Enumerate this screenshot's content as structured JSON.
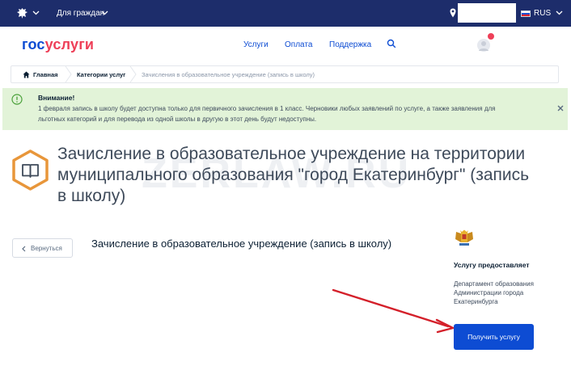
{
  "topbar": {
    "for_citizens_label": "Для граждан",
    "language": "RUS"
  },
  "header": {
    "logo_part1": "гос",
    "logo_part2": "услуги",
    "nav": [
      "Услуги",
      "Оплата",
      "Поддержка"
    ]
  },
  "breadcrumbs": [
    "Главная",
    "Категории услуг",
    "Зачисления в образовательное учреждение (запись в школу)"
  ],
  "notice": {
    "title": "Внимание!",
    "text": "1 февраля запись в школу будет доступна только для первичного зачисления в 1 класс. Черновики любых заявлений по услуге, а также заявления для льготных категорий и для перевода из одной школы в другую в этот день будут недоступны."
  },
  "service": {
    "title": "Зачисление в образовательное учреждение на территории муниципального образования \"город Екатеринбург\" (запись в школу)",
    "subtitle": "Зачисление в образовательное учреждение (запись в школу)",
    "back_label": "Вернуться",
    "provider_heading": "Услугу предоставляет",
    "provider_name": "Департамент образования Администрации города Екатеринбурга",
    "get_service_label": "Получить услугу"
  },
  "watermark": "ZERLAW.RU",
  "colors": {
    "topbar": "#1d2d6b",
    "brand_blue": "#0d4cd3",
    "brand_red": "#ee3f58",
    "notice_bg": "#e2f3d8",
    "arrow_red": "#d4202a"
  }
}
